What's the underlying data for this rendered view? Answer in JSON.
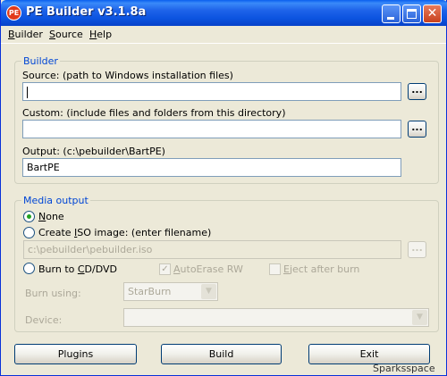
{
  "window": {
    "title": "PE Builder v3.1.8a",
    "icon_text": "PE",
    "close_glyph": "✕"
  },
  "menu": {
    "builder_first": "B",
    "builder_rest": "uilder",
    "source_first": "S",
    "source_rest": "ource",
    "help_first": "H",
    "help_rest": "elp"
  },
  "builder": {
    "group_label": "Builder",
    "source_label": "Source: (path to Windows installation files)",
    "source_value": "",
    "custom_label": "Custom: (include files and folders from this directory)",
    "custom_value": "",
    "output_label": "Output: (c:\\pebuilder\\BartPE)",
    "output_value": "BartPE",
    "browse_label": "..."
  },
  "media": {
    "group_label": "Media output",
    "none_label": "None",
    "none_first": "N",
    "none_rest": "one",
    "iso_label_pre": "Create ",
    "iso_first": "I",
    "iso_label_post": "SO image: (enter filename)",
    "iso_value": "c:\\pebuilder\\pebuilder.iso",
    "burn_label_pre": "Burn to ",
    "burn_first": "C",
    "burn_label_post": "D/DVD",
    "autoerase_first": "A",
    "autoerase_rest": "utoErase RW",
    "eject_first": "E",
    "eject_rest": "ject after burn",
    "burn_using_label": "Burn using:",
    "burn_using_value": "StarBurn",
    "device_label": "Device:",
    "device_value": "",
    "selected": "none",
    "autoerase_checked": true,
    "eject_checked": false
  },
  "buttons": {
    "plugins": "Plugins",
    "build": "Build",
    "exit": "Exit"
  },
  "watermark": "Sparksspace"
}
